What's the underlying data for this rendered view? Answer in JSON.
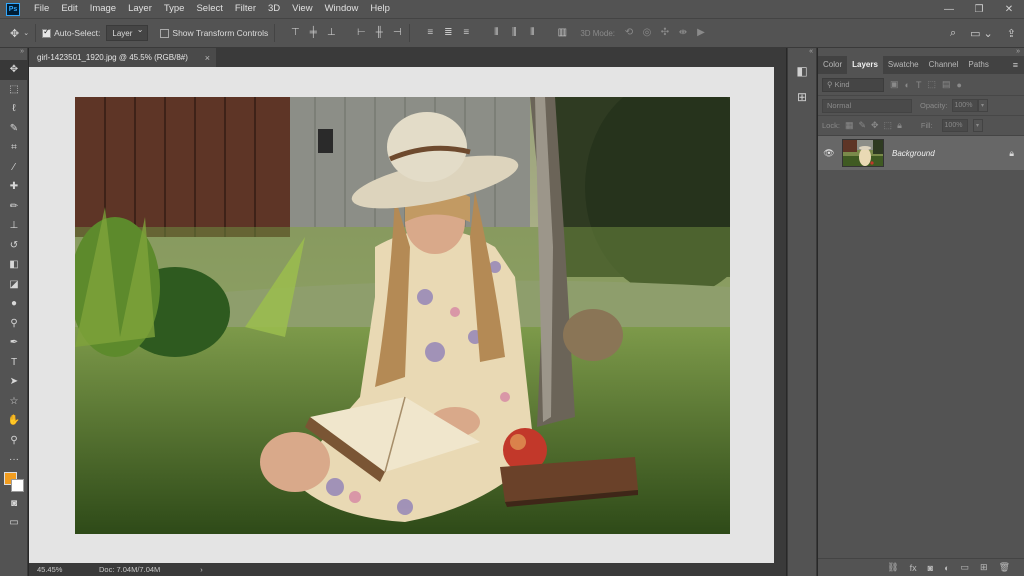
{
  "app": {
    "logo": "Ps"
  },
  "menu": [
    "File",
    "Edit",
    "Image",
    "Layer",
    "Type",
    "Select",
    "Filter",
    "3D",
    "View",
    "Window",
    "Help"
  ],
  "window_controls": [
    "—",
    "❐",
    "✕"
  ],
  "options": {
    "auto_select_label": "Auto-Select:",
    "auto_select_checked": true,
    "auto_select_target": "Layer",
    "show_transform_label": "Show Transform Controls",
    "show_transform_checked": false,
    "mode3d_label": "3D Mode:"
  },
  "document": {
    "tab_title": "girl-1423501_1920.jpg @ 45.5% (RGB/8#)",
    "close": "×"
  },
  "status": {
    "zoom": "45.45%",
    "doc_size": "Doc: 7.04M/7.04M",
    "arrow": "›"
  },
  "panel": {
    "tabs": [
      "Color",
      "Layers",
      "Swatche",
      "Channel",
      "Paths"
    ],
    "active_tab": "Layers",
    "filter_kind": "Kind",
    "blend_mode": "Normal",
    "opacity_label": "Opacity:",
    "opacity_value": "100%",
    "lock_label": "Lock:",
    "fill_label": "Fill:",
    "fill_value": "100%",
    "layers": [
      {
        "name": "Background",
        "visible": true,
        "locked": true
      }
    ]
  },
  "colors": {
    "foreground": "#f29d1f",
    "background": "#ffffff"
  }
}
